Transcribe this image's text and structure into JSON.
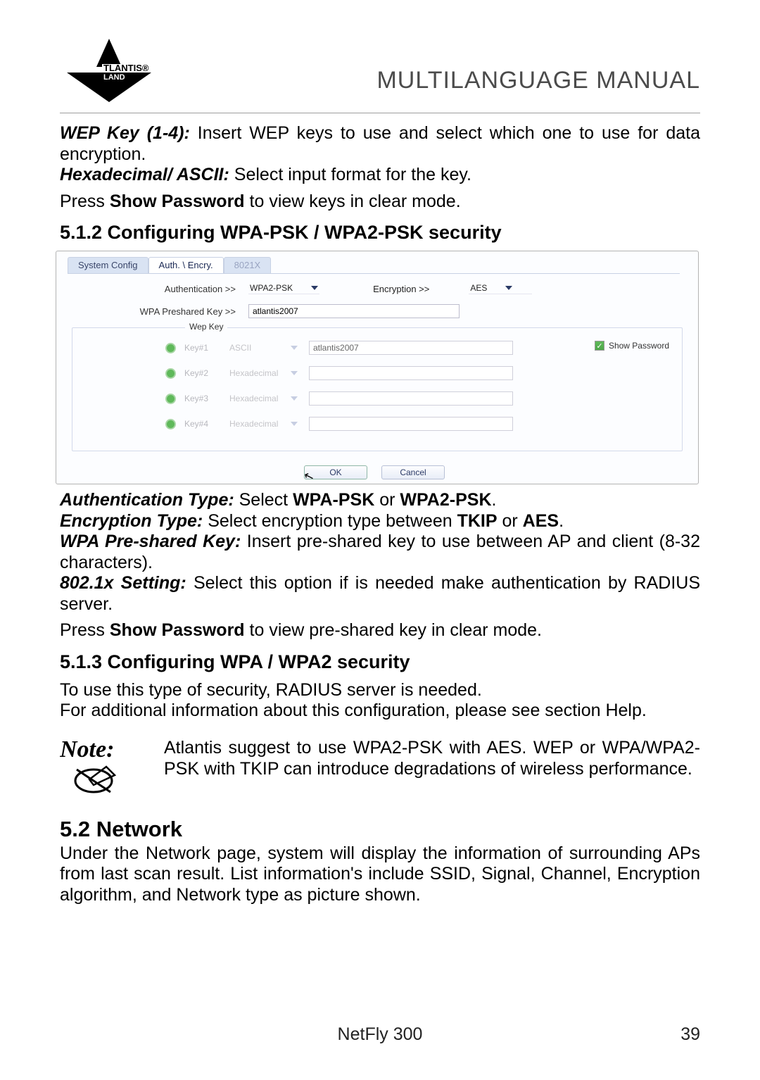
{
  "header": {
    "brand": "ATLANTIS",
    "subbrand": "LAND",
    "title": "MULTILANGUAGE MANUAL"
  },
  "intro": {
    "wep_label": "WEP Key (1-4):",
    "wep_text": " Insert WEP keys to use and select which one to use for data encryption.",
    "hex_label": "Hexadecimal/ ASCII:",
    "hex_text": " Select input format for the key.",
    "press_pre": "Press ",
    "show_pw": "Show Password",
    "press_post": " to view keys in clear mode."
  },
  "sec512": {
    "heading": "5.1.2 Configuring WPA-PSK / WPA2-PSK security"
  },
  "screenshot": {
    "tabs": {
      "sys": "System Config",
      "auth": "Auth. \\ Encry.",
      "dot1x": "8021X"
    },
    "labels": {
      "authentication": "Authentication >>",
      "encryption": "Encryption >>",
      "psk": "WPA Preshared Key >>",
      "wep_group": "Wep Key"
    },
    "values": {
      "auth_sel": "WPA2-PSK",
      "enc_sel": "AES",
      "psk_val": "atlantis2007"
    },
    "keys": [
      {
        "name": "Key#1",
        "fmt": "ASCII",
        "val": "atlantis2007"
      },
      {
        "name": "Key#2",
        "fmt": "Hexadecimal",
        "val": ""
      },
      {
        "name": "Key#3",
        "fmt": "Hexadecimal",
        "val": ""
      },
      {
        "name": "Key#4",
        "fmt": "Hexadecimal",
        "val": ""
      }
    ],
    "show_pw": "Show Password",
    "ok": "OK",
    "cancel": "Cancel"
  },
  "after": {
    "auth_lbl": "Authentication Type:",
    "auth_txt_a": " Select ",
    "auth_b1": "WPA-PSK",
    "auth_or": " or ",
    "auth_b2": "WPA2-PSK",
    "auth_end": ".",
    "enc_lbl": "Encryption Type:",
    "enc_txt_a": " Select encryption type between ",
    "enc_b1": "TKIP",
    "enc_or": " or ",
    "enc_b2": "AES",
    "enc_end": ".",
    "wpa_lbl": "WPA Pre-shared Key:",
    "wpa_txt": " Insert pre-shared key to use between AP and client (8-32 characters).",
    "dot1x_lbl": "802.1x Setting:",
    "dot1x_txt": " Select this option if is needed make authentication by RADIUS server.",
    "press_pre": "Press ",
    "show_pw": "Show Password",
    "press_post": " to view pre-shared key in clear mode."
  },
  "sec513": {
    "heading": "5.1.3 Configuring WPA  / WPA2 security",
    "p1": "To use this type of security, RADIUS server is needed.",
    "p2": "For additional information about this configuration, please see section Help."
  },
  "note": {
    "label": "Note:",
    "text": "Atlantis suggest to use WPA2-PSK with AES. WEP or WPA/WPA2-PSK with TKIP can introduce degradations of wireless performance."
  },
  "sec52": {
    "heading": "5.2 Network",
    "p": "Under the Network page, system will display the information of surrounding APs from last scan result. List information's include SSID, Signal, Channel, Encryption algorithm, and Network type as picture shown."
  },
  "footer": {
    "product": "NetFly 300",
    "page": "39"
  }
}
